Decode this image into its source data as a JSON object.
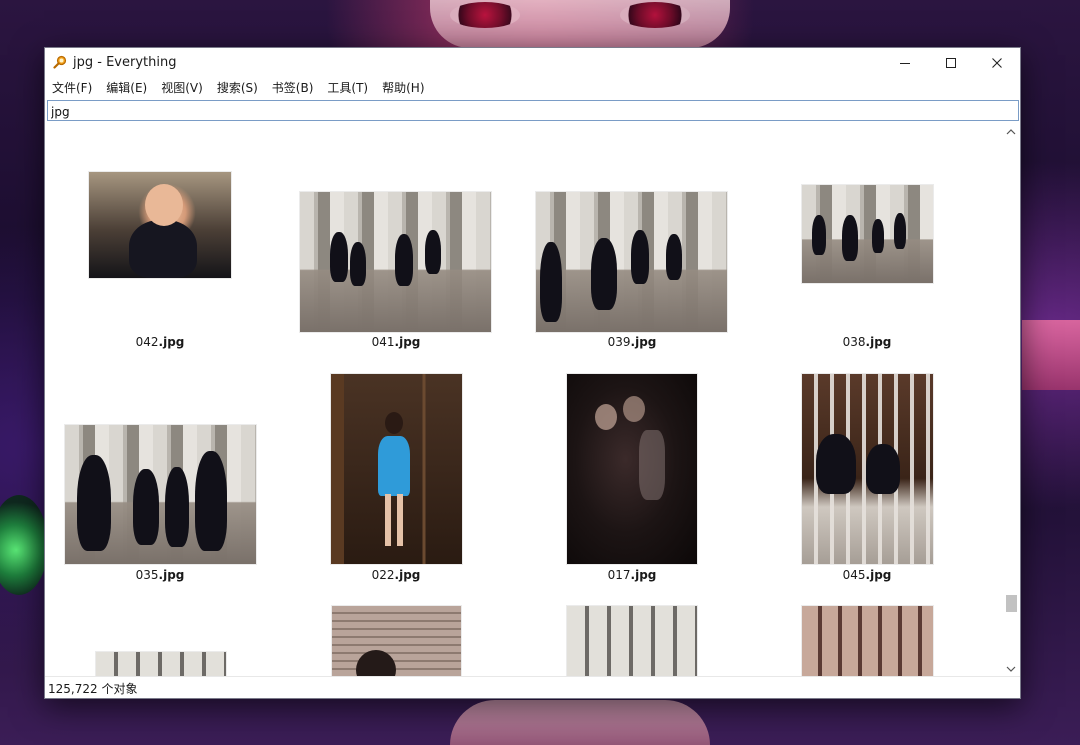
{
  "window": {
    "title": "jpg - Everything",
    "controls": {
      "minimize": "minimize",
      "maximize": "maximize",
      "close": "close"
    }
  },
  "menu": [
    "文件(F)",
    "编辑(E)",
    "视图(V)",
    "搜索(S)",
    "书签(B)",
    "工具(T)",
    "帮助(H)"
  ],
  "search": {
    "value": "jpg"
  },
  "results": [
    {
      "stem": "042",
      "ext": ".jpg"
    },
    {
      "stem": "041",
      "ext": ".jpg"
    },
    {
      "stem": "039",
      "ext": ".jpg"
    },
    {
      "stem": "038",
      "ext": ".jpg"
    },
    {
      "stem": "035",
      "ext": ".jpg"
    },
    {
      "stem": "022",
      "ext": ".jpg"
    },
    {
      "stem": "017",
      "ext": ".jpg"
    },
    {
      "stem": "045",
      "ext": ".jpg"
    }
  ],
  "status": {
    "count_text": "125,722 个对象"
  },
  "icons": {
    "app": "magnifier-icon",
    "scroll_up": "chevron-up-icon",
    "scroll_down": "chevron-down-icon"
  },
  "colors": {
    "search_border": "#7a9cc6",
    "window_bg": "#ffffff",
    "scroll_thumb": "#c2c2c2"
  }
}
